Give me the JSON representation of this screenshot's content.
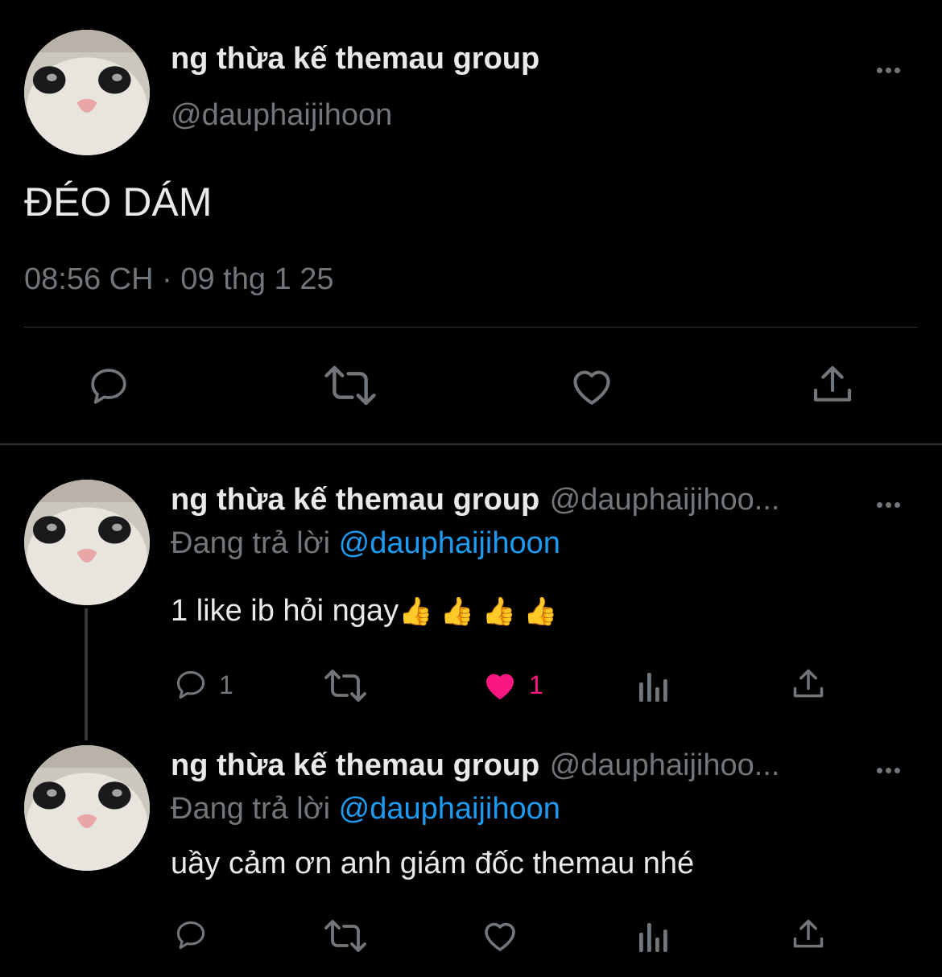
{
  "main_tweet": {
    "display_name": "ng thừa kế themau group",
    "handle": "@dauphaijihoon",
    "text": "ĐÉO DÁM",
    "timestamp": "08:56 CH · 09 thg 1 25",
    "actions": [
      "reply-icon",
      "retweet-icon",
      "like-icon",
      "share-icon"
    ]
  },
  "replies": [
    {
      "display_name": "ng thừa kế themau group",
      "handle": "@dauphaijihoo...",
      "reply_prefix": "Đang trả lời",
      "reply_mention": "@dauphaijihoon",
      "text": "1 like ib hỏi ngay",
      "emoji": "👍 👍 👍 👍",
      "reply_count": "1",
      "retweet_count": "",
      "like_count": "1",
      "liked": true
    },
    {
      "display_name": "ng thừa kế themau group",
      "handle": "@dauphaijihoo...",
      "reply_prefix": "Đang trả lời",
      "reply_mention": "@dauphaijihoon",
      "text": "uầy cảm ơn anh giám đốc themau nhé",
      "reply_count": "",
      "retweet_count": "",
      "like_count": "",
      "liked": false
    }
  ],
  "colors": {
    "background": "#000000",
    "text": "#e7e9ea",
    "muted": "#71767b",
    "accent": "#1d9bf0",
    "like": "#f91880",
    "divider": "#2f3336"
  }
}
